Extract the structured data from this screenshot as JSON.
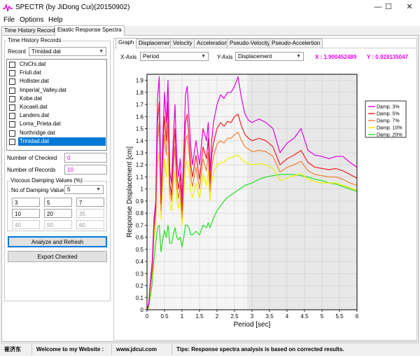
{
  "window": {
    "title": "SPECTR (by JiDong Cui)(20150902)",
    "minimize_glyph": "—",
    "maximize_glyph": "☐",
    "close_glyph": "✕"
  },
  "menu": [
    "File",
    "Options",
    "Help"
  ],
  "outer_tabs": [
    {
      "label": "Time History Records",
      "active": false
    },
    {
      "label": "Elastic Response Spectra",
      "active": true
    }
  ],
  "left": {
    "group_title": "Time History Records",
    "record_label": "Record",
    "record_value": "Trinidad.dat",
    "files": [
      {
        "name": "ChiChi.dat",
        "checked": false,
        "selected": false
      },
      {
        "name": "Friuli.dat",
        "checked": false,
        "selected": false
      },
      {
        "name": "Hollister.dat",
        "checked": false,
        "selected": false
      },
      {
        "name": "Imperial_Valley.dat",
        "checked": false,
        "selected": false
      },
      {
        "name": "Kobe.dat",
        "checked": false,
        "selected": false
      },
      {
        "name": "Kocaeli.dat",
        "checked": false,
        "selected": false
      },
      {
        "name": "Landers.dat",
        "checked": false,
        "selected": false
      },
      {
        "name": "Loma_Prieta.dat",
        "checked": false,
        "selected": false
      },
      {
        "name": "Northridge.dat",
        "checked": false,
        "selected": false
      },
      {
        "name": "Trinidad.dat",
        "checked": false,
        "selected": true
      }
    ],
    "checked_label": "Number of Checked",
    "checked_value": "0",
    "records_label": "Number of Records",
    "records_value": "10",
    "damping_group_title": "Viscous Damping Values (%)",
    "damping_count_label": "No.of Damping Values",
    "damping_count_value": "5",
    "damping_values": [
      "3",
      "5",
      "7",
      "10",
      "20",
      "35",
      "40",
      "50",
      "60"
    ],
    "analyze_button": "Analyze and Refresh",
    "export_button": "Export Checked"
  },
  "right": {
    "tabs": [
      "Graph",
      "Displacement",
      "Velocity",
      "Acceleration",
      "Pseudo-Velocity",
      "Pseudo-Accelertion"
    ],
    "active_tab": "Graph",
    "xaxis_label": "X-Axis",
    "xaxis_value": "Period",
    "yaxis_label": "Y-Axis",
    "yaxis_value": "Displacement",
    "cursor_x": "X : 1.900452489",
    "cursor_y": "Y : 0.929135047"
  },
  "status": {
    "author": "崔济东",
    "welcome": "Welcome to my Website :",
    "website": "www.jdcui.com",
    "tips": "Tips: Response spectra analysis is based on corrected results."
  },
  "chart_data": {
    "type": "line",
    "xlabel": "Period [sec]",
    "ylabel": "Response Displacement [cm]",
    "xlim": [
      0,
      6
    ],
    "ylim": [
      0,
      1.95
    ],
    "xticks": [
      "0",
      "0.5",
      "1",
      "1.5",
      "2",
      "2.5",
      "3",
      "3.5",
      "4",
      "4.5",
      "5",
      "5.5",
      "6"
    ],
    "yticks": [
      "0",
      "0.1",
      "0.2",
      "0.3",
      "0.4",
      "0.5",
      "0.6",
      "0.7",
      "0.8",
      "0.9",
      "1",
      "1.1",
      "1.2",
      "1.3",
      "1.4",
      "1.5",
      "1.6",
      "1.7",
      "1.8",
      "1.9"
    ],
    "legend_position": "top-right",
    "series": [
      {
        "name": "Damp. 3%",
        "color": "#e000e0",
        "x": [
          0,
          0.05,
          0.1,
          0.15,
          0.2,
          0.25,
          0.3,
          0.35,
          0.4,
          0.45,
          0.5,
          0.55,
          0.6,
          0.65,
          0.7,
          0.75,
          0.8,
          0.85,
          0.9,
          0.95,
          1.0,
          1.05,
          1.1,
          1.15,
          1.2,
          1.25,
          1.3,
          1.4,
          1.5,
          1.6,
          1.7,
          1.75,
          1.8,
          1.85,
          1.9,
          2.0,
          2.1,
          2.2,
          2.3,
          2.4,
          2.5,
          2.6,
          2.7,
          2.8,
          2.9,
          3.0,
          3.2,
          3.4,
          3.6,
          3.8,
          4.0,
          4.2,
          4.4,
          4.6,
          4.8,
          5.0,
          5.2,
          5.4,
          5.6,
          5.8,
          6.0
        ],
        "y": [
          0,
          0.05,
          0.25,
          0.4,
          0.75,
          0.9,
          1.75,
          1.93,
          0.95,
          1.4,
          1.8,
          1.55,
          1.9,
          1.15,
          1.05,
          1.4,
          1.7,
          1.25,
          1.1,
          1.25,
          0.9,
          1.3,
          1.78,
          1.85,
          1.6,
          1.35,
          1.2,
          1.4,
          1.2,
          1.5,
          1.4,
          1.55,
          1.15,
          1.4,
          1.55,
          1.7,
          1.78,
          1.75,
          1.8,
          1.8,
          1.85,
          1.93,
          1.75,
          1.62,
          1.57,
          1.55,
          1.58,
          1.55,
          1.5,
          1.3,
          1.38,
          1.42,
          1.5,
          1.32,
          1.28,
          1.27,
          1.25,
          1.27,
          1.27,
          1.22,
          1.18
        ]
      },
      {
        "name": "Damp. 5%",
        "color": "#f02020",
        "x": [
          0,
          0.05,
          0.1,
          0.15,
          0.2,
          0.25,
          0.3,
          0.35,
          0.4,
          0.45,
          0.5,
          0.55,
          0.6,
          0.65,
          0.7,
          0.75,
          0.8,
          0.85,
          0.9,
          0.95,
          1.0,
          1.05,
          1.1,
          1.15,
          1.2,
          1.25,
          1.3,
          1.4,
          1.5,
          1.6,
          1.7,
          1.75,
          1.8,
          1.85,
          1.9,
          2.0,
          2.1,
          2.2,
          2.3,
          2.4,
          2.5,
          2.6,
          2.7,
          2.8,
          2.9,
          3.0,
          3.2,
          3.4,
          3.6,
          3.8,
          4.0,
          4.2,
          4.4,
          4.6,
          4.8,
          5.0,
          5.2,
          5.4,
          5.6,
          5.8,
          6.0
        ],
        "y": [
          0,
          0.04,
          0.22,
          0.35,
          0.7,
          0.85,
          1.55,
          1.72,
          0.88,
          1.3,
          1.6,
          1.4,
          1.72,
          1.05,
          0.95,
          1.25,
          1.5,
          1.12,
          1.0,
          1.12,
          0.82,
          1.18,
          1.55,
          1.62,
          1.42,
          1.2,
          1.1,
          1.28,
          1.08,
          1.35,
          1.25,
          1.42,
          1.05,
          1.28,
          1.38,
          1.5,
          1.55,
          1.52,
          1.56,
          1.55,
          1.6,
          1.62,
          1.52,
          1.45,
          1.42,
          1.4,
          1.42,
          1.4,
          1.35,
          1.2,
          1.25,
          1.28,
          1.32,
          1.22,
          1.18,
          1.17,
          1.16,
          1.17,
          1.15,
          1.12,
          1.09
        ]
      },
      {
        "name": "Damp. 7%",
        "color": "#f08030",
        "x": [
          0,
          0.05,
          0.1,
          0.15,
          0.2,
          0.25,
          0.3,
          0.35,
          0.4,
          0.45,
          0.5,
          0.55,
          0.6,
          0.65,
          0.7,
          0.75,
          0.8,
          0.85,
          0.9,
          0.95,
          1.0,
          1.05,
          1.1,
          1.15,
          1.2,
          1.25,
          1.3,
          1.4,
          1.5,
          1.6,
          1.7,
          1.75,
          1.8,
          1.85,
          1.9,
          2.0,
          2.1,
          2.2,
          2.3,
          2.4,
          2.5,
          2.6,
          2.7,
          2.8,
          2.9,
          3.0,
          3.2,
          3.4,
          3.6,
          3.8,
          4.0,
          4.2,
          4.4,
          4.6,
          4.8,
          5.0,
          5.2,
          5.4,
          5.6,
          5.8,
          6.0
        ],
        "y": [
          0,
          0.04,
          0.2,
          0.32,
          0.65,
          0.8,
          1.4,
          1.55,
          0.82,
          1.2,
          1.45,
          1.28,
          1.55,
          0.98,
          0.9,
          1.15,
          1.35,
          1.02,
          0.92,
          1.03,
          0.76,
          1.08,
          1.4,
          1.45,
          1.3,
          1.1,
          1.02,
          1.18,
          1.0,
          1.25,
          1.15,
          1.3,
          0.98,
          1.18,
          1.27,
          1.37,
          1.4,
          1.38,
          1.42,
          1.42,
          1.45,
          1.47,
          1.4,
          1.35,
          1.33,
          1.31,
          1.32,
          1.31,
          1.27,
          1.14,
          1.18,
          1.2,
          1.23,
          1.15,
          1.12,
          1.11,
          1.1,
          1.1,
          1.08,
          1.05,
          1.03
        ]
      },
      {
        "name": "Damp. 10%",
        "color": "#f0f000",
        "x": [
          0,
          0.05,
          0.1,
          0.15,
          0.2,
          0.25,
          0.3,
          0.35,
          0.4,
          0.45,
          0.5,
          0.55,
          0.6,
          0.65,
          0.7,
          0.75,
          0.8,
          0.85,
          0.9,
          0.95,
          1.0,
          1.05,
          1.1,
          1.15,
          1.2,
          1.25,
          1.3,
          1.4,
          1.5,
          1.6,
          1.7,
          1.75,
          1.8,
          1.85,
          1.9,
          2.0,
          2.1,
          2.2,
          2.3,
          2.4,
          2.5,
          2.6,
          2.7,
          2.8,
          2.9,
          3.0,
          3.2,
          3.4,
          3.6,
          3.8,
          4.0,
          4.2,
          4.4,
          4.6,
          4.8,
          5.0,
          5.2,
          5.4,
          5.6,
          5.8,
          6.0
        ],
        "y": [
          0,
          0.03,
          0.17,
          0.28,
          0.58,
          0.72,
          1.2,
          1.3,
          0.75,
          1.05,
          1.25,
          1.1,
          1.3,
          0.88,
          0.82,
          1.02,
          1.15,
          0.92,
          0.84,
          0.93,
          0.7,
          0.95,
          1.2,
          1.23,
          1.13,
          0.98,
          0.93,
          1.05,
          0.92,
          1.12,
          1.03,
          1.15,
          0.9,
          1.06,
          1.13,
          1.2,
          1.22,
          1.22,
          1.25,
          1.26,
          1.27,
          1.28,
          1.25,
          1.22,
          1.21,
          1.2,
          1.21,
          1.2,
          1.17,
          1.07,
          1.09,
          1.11,
          1.13,
          1.08,
          1.06,
          1.05,
          1.05,
          1.05,
          1.03,
          1.01,
          0.99
        ]
      },
      {
        "name": "Damp. 20%",
        "color": "#20e020",
        "x": [
          0,
          0.05,
          0.1,
          0.15,
          0.2,
          0.25,
          0.3,
          0.35,
          0.4,
          0.45,
          0.5,
          0.55,
          0.6,
          0.65,
          0.7,
          0.75,
          0.8,
          0.85,
          0.9,
          0.95,
          1.0,
          1.05,
          1.1,
          1.15,
          1.2,
          1.25,
          1.3,
          1.4,
          1.5,
          1.6,
          1.7,
          1.75,
          1.8,
          1.85,
          1.9,
          2.0,
          2.1,
          2.2,
          2.3,
          2.4,
          2.5,
          2.6,
          2.7,
          2.8,
          2.9,
          3.0,
          3.2,
          3.4,
          3.6,
          3.8,
          4.0,
          4.2,
          4.4,
          4.6,
          4.8,
          5.0,
          5.2,
          5.4,
          5.6,
          5.8,
          6.0
        ],
        "y": [
          0,
          0.02,
          0.12,
          0.22,
          0.42,
          0.55,
          0.68,
          0.7,
          0.48,
          0.58,
          0.66,
          0.6,
          0.7,
          0.55,
          0.55,
          0.62,
          0.68,
          0.6,
          0.58,
          0.6,
          0.52,
          0.6,
          0.7,
          0.7,
          0.68,
          0.62,
          0.62,
          0.65,
          0.62,
          0.7,
          0.68,
          0.72,
          0.68,
          0.72,
          0.76,
          0.82,
          0.86,
          0.9,
          0.93,
          0.95,
          0.97,
          0.99,
          1.01,
          1.03,
          1.04,
          1.05,
          1.08,
          1.1,
          1.11,
          1.12,
          1.12,
          1.12,
          1.11,
          1.1,
          1.08,
          1.07,
          1.05,
          1.04,
          1.02,
          1.0,
          0.98
        ]
      }
    ]
  }
}
